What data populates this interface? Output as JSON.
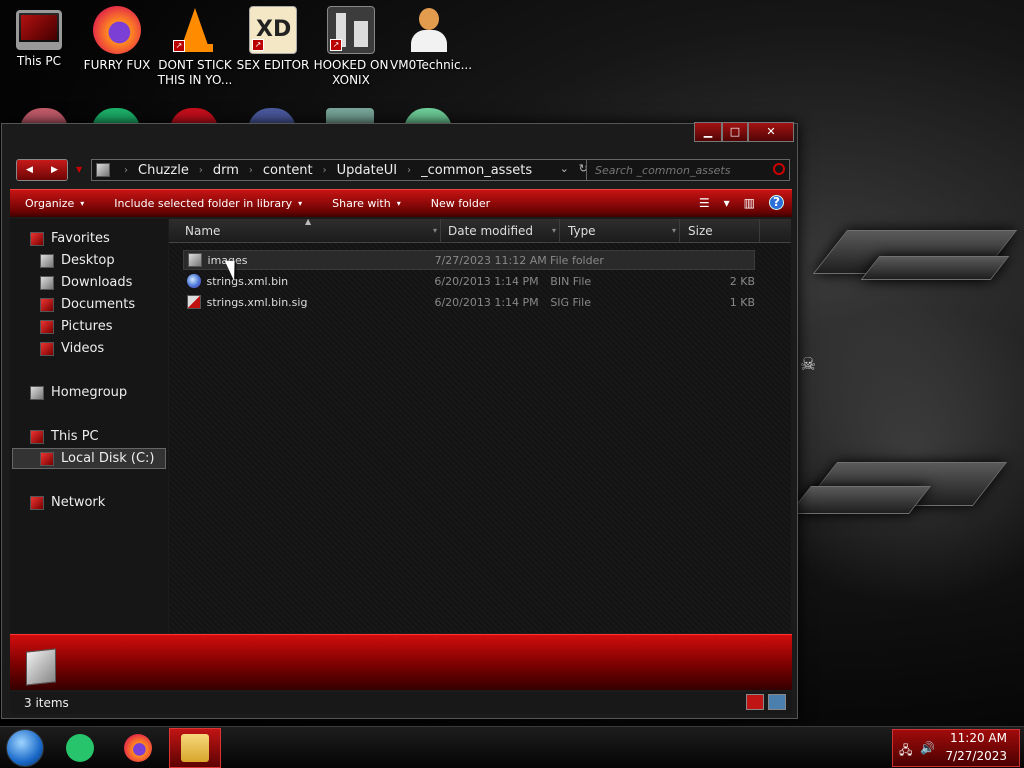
{
  "desktop": {
    "icons": [
      {
        "label": "This PC",
        "icon": "monitor-icon"
      },
      {
        "label": "FURRY FUX",
        "icon": "firefox-icon"
      },
      {
        "label": "DONT STICK THIS IN YO...",
        "icon": "vlc-cone-icon"
      },
      {
        "label": "SEX EDITOR",
        "icon": "hex-editor-icon"
      },
      {
        "label": "HOOKED ON XONIX",
        "icon": "xonix-game-icon"
      },
      {
        "label": "VM0Technic...",
        "icon": "doctor-avatar-icon"
      }
    ],
    "colors": {
      "accent": "#c01414",
      "background": "#000000"
    }
  },
  "window": {
    "controls": {
      "minimize": "▁",
      "maximize": "□",
      "close": "✕"
    },
    "nav": {
      "back": "◀",
      "forward": "▶",
      "recent": "▼"
    },
    "breadcrumb": [
      "Chuzzle",
      "drm",
      "content",
      "UpdateUI",
      "_common_assets"
    ],
    "address_dropdown": "⌄",
    "refresh": "↻",
    "search": {
      "placeholder": "Search _common_assets"
    },
    "toolbar": {
      "organize": "Organize",
      "include_library": "Include selected folder in library",
      "share_with": "Share with",
      "new_folder": "New folder",
      "dropdown_arrow": "▾"
    },
    "navpane": {
      "favorites": "Favorites",
      "desktop": "Desktop",
      "downloads": "Downloads",
      "documents": "Documents",
      "pictures": "Pictures",
      "videos": "Videos",
      "homegroup": "Homegroup",
      "this_pc": "This PC",
      "local_disk": "Local Disk (C:)",
      "network": "Network"
    },
    "columns": {
      "name": "Name",
      "date": "Date modified",
      "type": "Type",
      "size": "Size",
      "sort_arrow": "▲",
      "col_dropdown": "▾"
    },
    "files": [
      {
        "name": "images",
        "date": "7/27/2023 11:12 AM",
        "type": "File folder",
        "size": "",
        "icon": "folder-icon"
      },
      {
        "name": "strings.xml.bin",
        "date": "6/20/2013 1:14 PM",
        "type": "BIN File",
        "size": "2 KB",
        "icon": "bin-file-icon"
      },
      {
        "name": "strings.xml.bin.sig",
        "date": "6/20/2013 1:14 PM",
        "type": "SIG File",
        "size": "1 KB",
        "icon": "sig-file-icon"
      }
    ],
    "status": {
      "item_count": "3 items"
    }
  },
  "taskbar": {
    "apps": [
      {
        "name": "Chat app",
        "icon": "chat-icon"
      },
      {
        "name": "Firefox",
        "icon": "firefox-icon"
      },
      {
        "name": "File Explorer",
        "icon": "file-explorer-icon",
        "active": true
      }
    ],
    "tray": {
      "network": "🖧",
      "volume": "🔊"
    },
    "clock": {
      "time": "11:20 AM",
      "date": "7/27/2023"
    }
  }
}
